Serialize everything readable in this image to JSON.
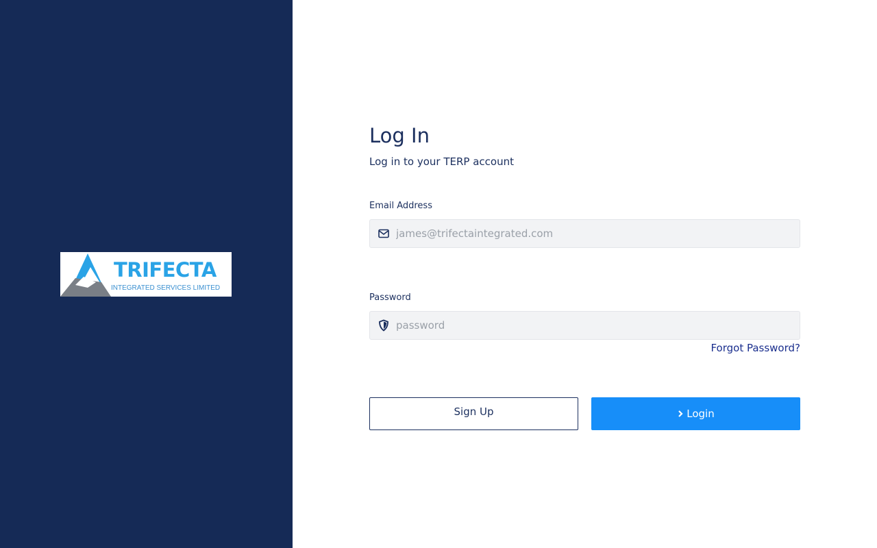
{
  "brand": {
    "logo_word": "TRIFECTA",
    "logo_sub": "INTEGRATED SERVICES LIMITED",
    "colors": {
      "panel": "#152a56",
      "logo_blue": "#2aa3e6",
      "logo_grey": "#7a7f86"
    }
  },
  "login": {
    "title": "Log In",
    "subtitle": "Log in to your TERP account",
    "email": {
      "label": "Email Address",
      "placeholder": "james@trifectaintegrated.com",
      "icon": "envelope-icon"
    },
    "password": {
      "label": "Password",
      "placeholder": "password",
      "icon": "shield-icon"
    },
    "forgot_label": "Forgot Password?",
    "signup_label": "Sign Up",
    "login_label": "Login",
    "colors": {
      "accent": "#178ef9",
      "text": "#1b2f5e"
    }
  }
}
